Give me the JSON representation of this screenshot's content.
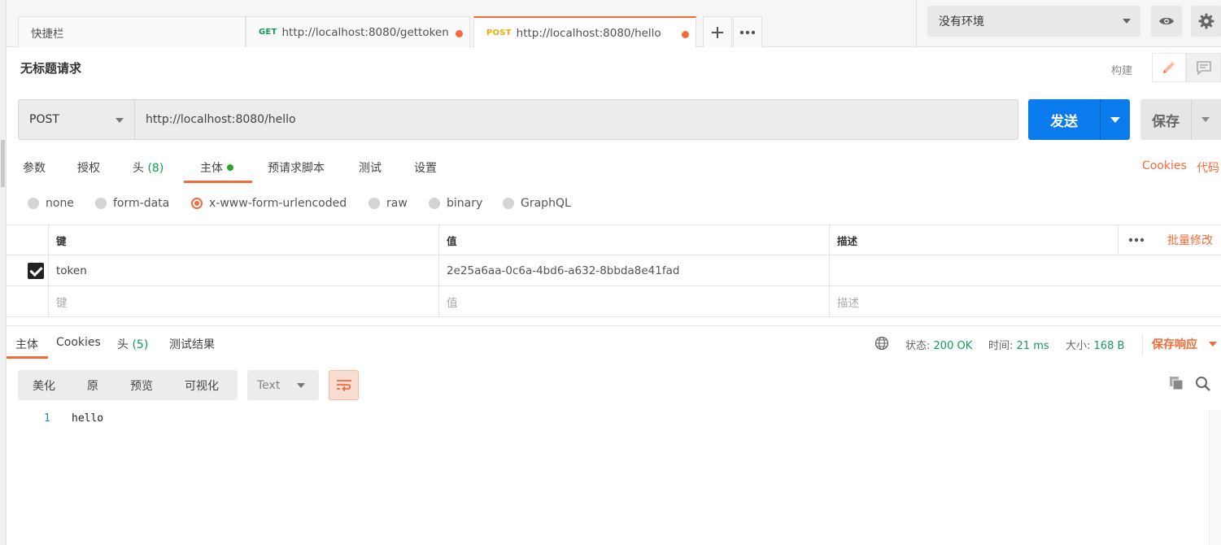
{
  "tabs": [
    {
      "label": "快捷栏",
      "method": ""
    },
    {
      "label": "http://localhost:8080/gettoken",
      "method": "GET"
    },
    {
      "label": "http://localhost:8080/hello",
      "method": "POST"
    }
  ],
  "environment": {
    "selected": "没有环境"
  },
  "request": {
    "title": "无标题请求",
    "build_label": "构建",
    "method": "POST",
    "url": "http://localhost:8080/hello",
    "send_label": "发送",
    "save_label": "保存"
  },
  "request_tabs": {
    "params": "参数",
    "auth": "授权",
    "headers": "头",
    "headers_count": "(8)",
    "body": "主体",
    "prerequest": "预请求脚本",
    "tests": "测试",
    "settings": "设置",
    "cookies": "Cookies",
    "code": "代码"
  },
  "body_modes": [
    {
      "label": "none",
      "selected": false
    },
    {
      "label": "form-data",
      "selected": false
    },
    {
      "label": "x-www-form-urlencoded",
      "selected": true
    },
    {
      "label": "raw",
      "selected": false
    },
    {
      "label": "binary",
      "selected": false
    },
    {
      "label": "GraphQL",
      "selected": false
    }
  ],
  "params_table": {
    "headers": {
      "key": "键",
      "value": "值",
      "description": "描述",
      "bulk_edit": "批量修改"
    },
    "rows": [
      {
        "checked": true,
        "key": "token",
        "value": "2e25a6aa-0c6a-4bd6-a632-8bbda8e41fad",
        "description": ""
      }
    ],
    "placeholders": {
      "key": "键",
      "value": "值",
      "description": "描述"
    }
  },
  "response": {
    "tabs": {
      "body": "主体",
      "cookies": "Cookies",
      "headers": "头",
      "headers_count": "(5)",
      "test_results": "测试结果"
    },
    "status_label": "状态:",
    "status": "200 OK",
    "time_label": "时间:",
    "time": "21 ms",
    "size_label": "大小:",
    "size": "168 B",
    "save_response": "保存响应",
    "view_modes": [
      "美化",
      "原",
      "预览",
      "可视化"
    ],
    "format": "Text",
    "lines": [
      {
        "num": "1",
        "text": "hello"
      }
    ]
  },
  "colors": {
    "accent": "#f26b3a",
    "primary": "#097bed",
    "success": "#0f9d58"
  }
}
